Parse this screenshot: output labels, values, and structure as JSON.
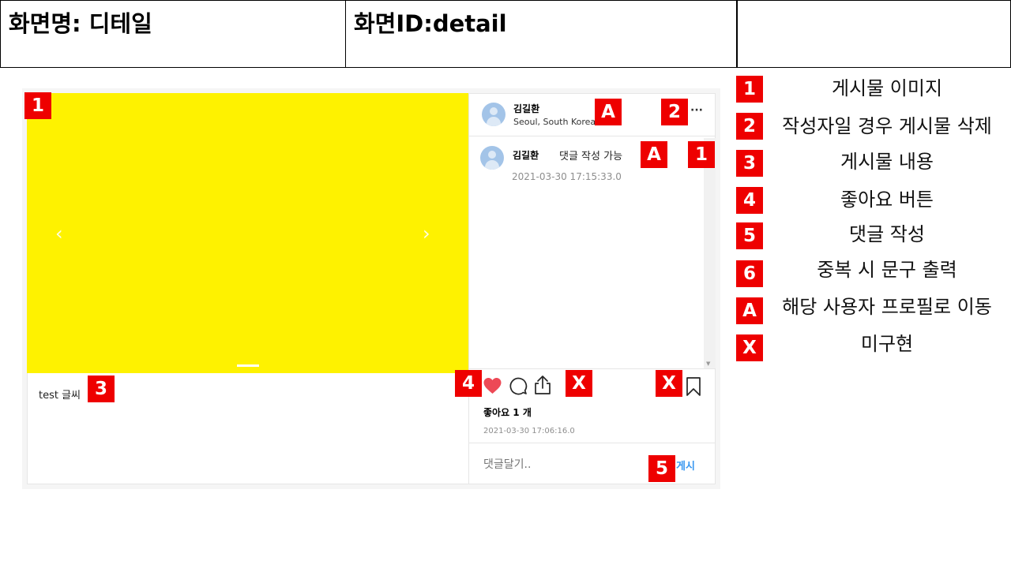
{
  "header": {
    "screen_name": "화면명: 디테일",
    "screen_id": "화면ID:detail",
    "extra": ""
  },
  "post": {
    "author": "김길환",
    "location": "Seoul, South Korea",
    "more": "···",
    "prev": "‹",
    "next": "›",
    "content": "test 글씨"
  },
  "comment": {
    "author": "김길환",
    "text": "댓글 작성 가능",
    "timestamp": "2021-03-30 17:15:33.0"
  },
  "actions": {
    "likes": "좋아요 1 개",
    "timestamp": "2021-03-30 17:06:16.0",
    "comment_placeholder": "댓글달기..",
    "post_button": "게시"
  },
  "badges": {
    "b1": "1",
    "b2": "2",
    "b3": "3",
    "b4": "4",
    "b5": "5",
    "bA": "A",
    "bX": "X"
  },
  "legend": [
    {
      "key": "1",
      "label": "게시물 이미지"
    },
    {
      "key": "2",
      "label": "작성자일 경우 게시물 삭제"
    },
    {
      "key": "3",
      "label": "게시물 내용"
    },
    {
      "key": "4",
      "label": "좋아요 버튼"
    },
    {
      "key": "5",
      "label": "댓글 작성"
    },
    {
      "key": "6",
      "label": "중복 시 문구 출력"
    },
    {
      "key": "A",
      "label": "해당 사용자 프로필로 이동"
    },
    {
      "key": "X",
      "label": "미구현"
    }
  ],
  "colors": {
    "badge": "#ee0000",
    "photo": "#fef200",
    "heart": "#ed4956",
    "link": "#3897f0"
  }
}
